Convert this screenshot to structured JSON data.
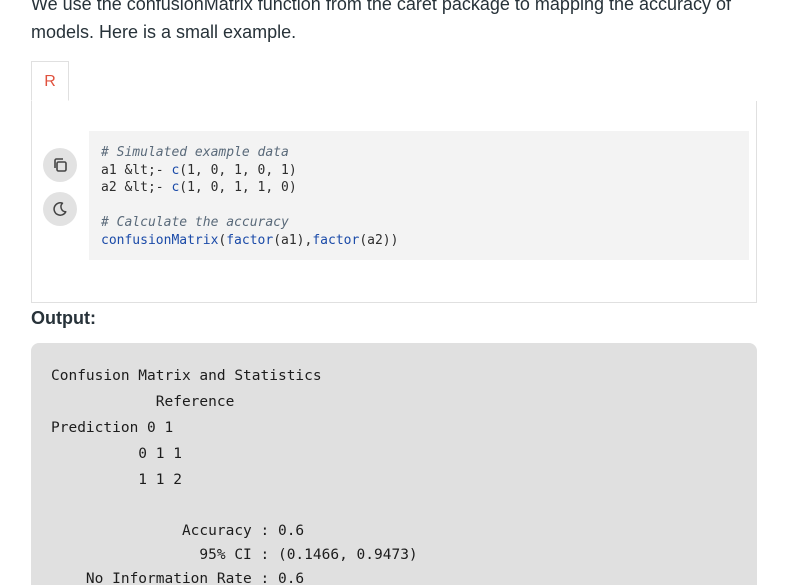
{
  "intro_text": "We use the confusionMatrix function from the caret package to mapping the accuracy of models. Here is a small example.",
  "tabs": [
    {
      "label": "R"
    }
  ],
  "code_icons": {
    "copy": "copy-icon",
    "theme": "moon-icon"
  },
  "code": {
    "lines": [
      {
        "text": "# Simulated example data",
        "kind": "comment"
      },
      {
        "text": "a1 &lt;- c(1, 0, 1, 0, 1)",
        "kind": "mixed",
        "parts": [
          "a1 &lt;- ",
          "c",
          "(1, 0, 1, 0, 1)"
        ]
      },
      {
        "text": "a2 &lt;- c(1, 0, 1, 1, 0)",
        "kind": "mixed",
        "parts": [
          "a2 &lt;- ",
          "c",
          "(1, 0, 1, 1, 0)"
        ]
      },
      {
        "text": "",
        "kind": "blank"
      },
      {
        "text": "# Calculate the accuracy",
        "kind": "comment"
      },
      {
        "text": "confusionMatrix(factor(a1),factor(a2))",
        "kind": "call",
        "parts": [
          "confusionMatrix",
          "(",
          "factor",
          "(a1),",
          "factor",
          "(a2))"
        ]
      }
    ]
  },
  "output_label": "Output:",
  "output": {
    "lines": [
      "Confusion Matrix and Statistics",
      "            Reference",
      "Prediction 0 1",
      "          0 1 1",
      "          1 1 2",
      "",
      "               Accuracy : 0.6",
      "                 95% CI : (0.1466, 0.9473)",
      "    No Information Rate : 0.6"
    ]
  },
  "colors": {
    "tab_accent": "#e0523e",
    "code_bg": "#f3f3f3",
    "output_bg": "#e0e0e0",
    "function_color": "#1a4aa8"
  }
}
